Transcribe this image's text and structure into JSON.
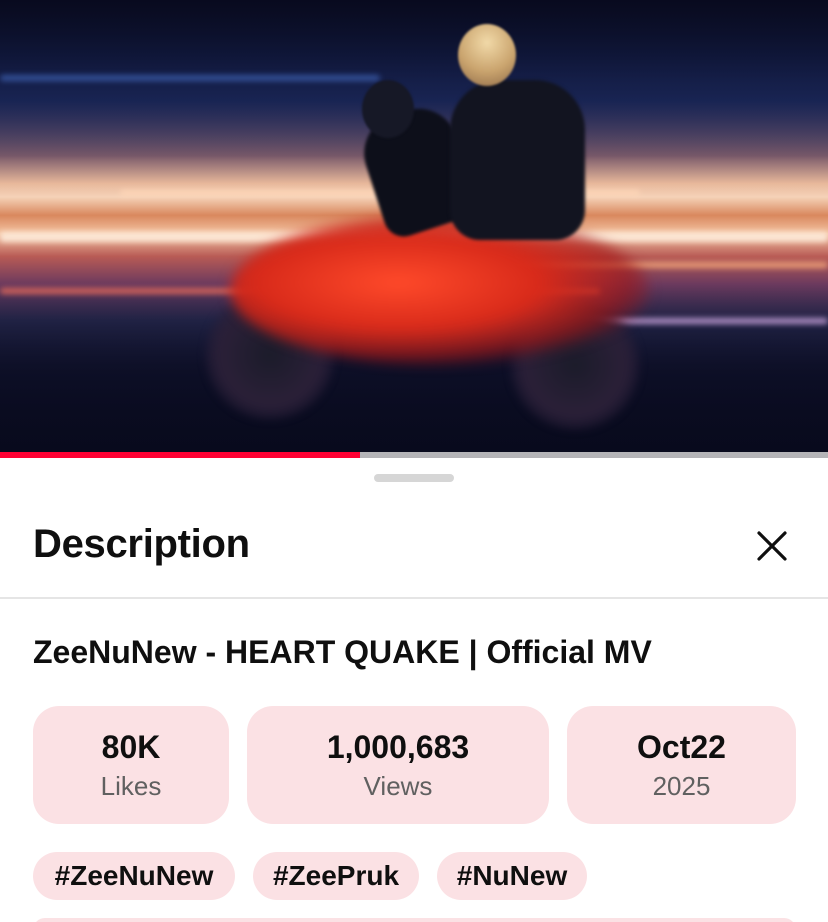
{
  "video": {
    "progress_fraction": 0.435,
    "accent_color": "#ff0033"
  },
  "sheet": {
    "title": "Description",
    "close_icon": "close-icon"
  },
  "description": {
    "video_title": "ZeeNuNew - HEART QUAKE | Official MV",
    "stats": [
      {
        "value": "80K",
        "label": "Likes"
      },
      {
        "value": "1,000,683",
        "label": "Views"
      },
      {
        "value": "Oct22",
        "label": "2025"
      }
    ],
    "hashtags": [
      "#ZeeNuNew",
      "#ZeePruk",
      "#NuNew"
    ],
    "chip_color": "#fbe1e4"
  }
}
